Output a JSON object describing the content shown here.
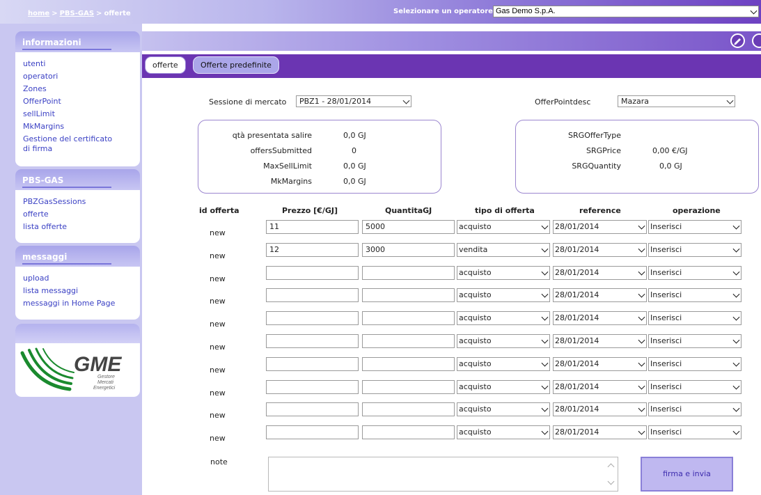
{
  "breadcrumb": {
    "home": "home",
    "sep1": ">",
    "section": "PBS-GAS",
    "sep2": ">",
    "current": "offerte"
  },
  "operator": {
    "label": "Selezionare un operatore",
    "value": "Gas Demo S.p.A."
  },
  "sidebar": {
    "informazioni": {
      "title": "informazioni",
      "items": [
        "utenti",
        "operatori",
        "Zones",
        "OfferPoint",
        "sellLimit",
        "MkMargins",
        "Gestione del certificato di firma"
      ]
    },
    "pbsgas": {
      "title": "PBS-GAS",
      "items": [
        "PBZGasSessions",
        "offerte",
        "lista offerte"
      ]
    },
    "messaggi": {
      "title": "messaggi",
      "items": [
        "upload",
        "lista messaggi",
        "messaggi in Home Page"
      ]
    },
    "logo": {
      "brand": "GME",
      "tagline": "Gestore Mercati Energetici"
    }
  },
  "tabs": {
    "offerte": "offerte",
    "predefinite": "Offerte predefinite"
  },
  "form": {
    "session_label": "Sessione di mercato",
    "session_value": "PBZ1 - 28/01/2014",
    "offerpoint_label": "OfferPointdesc",
    "offerpoint_value": "Mazara"
  },
  "summary_left": [
    {
      "label": "qtà presentata salire",
      "value": "0,0 GJ"
    },
    {
      "label": "offersSubmitted",
      "value": "0"
    },
    {
      "label": "MaxSellLimit",
      "value": "0,0 GJ"
    },
    {
      "label": "MkMargins",
      "value": "0,0 GJ"
    }
  ],
  "summary_right": [
    {
      "label": "SRGOfferType",
      "value": ""
    },
    {
      "label": "SRGPrice",
      "value": "0,00 €/GJ"
    },
    {
      "label": "SRGQuantity",
      "value": "0,0 GJ"
    }
  ],
  "table": {
    "headers": {
      "id": "id offerta",
      "price": "Prezzo [€/GJ]",
      "qty": "QuantitaGJ",
      "type": "tipo di offerta",
      "ref": "reference",
      "op": "operazione"
    },
    "rows": [
      {
        "id": "new",
        "price": "11",
        "qty": "5000",
        "type": "acquisto",
        "ref": "28/01/2014",
        "op": "Inserisci"
      },
      {
        "id": "new",
        "price": "12",
        "qty": "3000",
        "type": "vendita",
        "ref": "28/01/2014",
        "op": "Inserisci"
      },
      {
        "id": "new",
        "price": "",
        "qty": "",
        "type": "acquisto",
        "ref": "28/01/2014",
        "op": "Inserisci"
      },
      {
        "id": "new",
        "price": "",
        "qty": "",
        "type": "acquisto",
        "ref": "28/01/2014",
        "op": "Inserisci"
      },
      {
        "id": "new",
        "price": "",
        "qty": "",
        "type": "acquisto",
        "ref": "28/01/2014",
        "op": "Inserisci"
      },
      {
        "id": "new",
        "price": "",
        "qty": "",
        "type": "acquisto",
        "ref": "28/01/2014",
        "op": "Inserisci"
      },
      {
        "id": "new",
        "price": "",
        "qty": "",
        "type": "acquisto",
        "ref": "28/01/2014",
        "op": "Inserisci"
      },
      {
        "id": "new",
        "price": "",
        "qty": "",
        "type": "acquisto",
        "ref": "28/01/2014",
        "op": "Inserisci"
      },
      {
        "id": "new",
        "price": "",
        "qty": "",
        "type": "acquisto",
        "ref": "28/01/2014",
        "op": "Inserisci"
      },
      {
        "id": "new",
        "price": "",
        "qty": "",
        "type": "acquisto",
        "ref": "28/01/2014",
        "op": "Inserisci"
      }
    ]
  },
  "note_label": "note",
  "submit_label": "firma e invia",
  "colors": {
    "accent": "#6b35b2",
    "link": "#3b41c4",
    "sidebar": "#c9c7f1",
    "logo_green": "#1a8a2e"
  }
}
